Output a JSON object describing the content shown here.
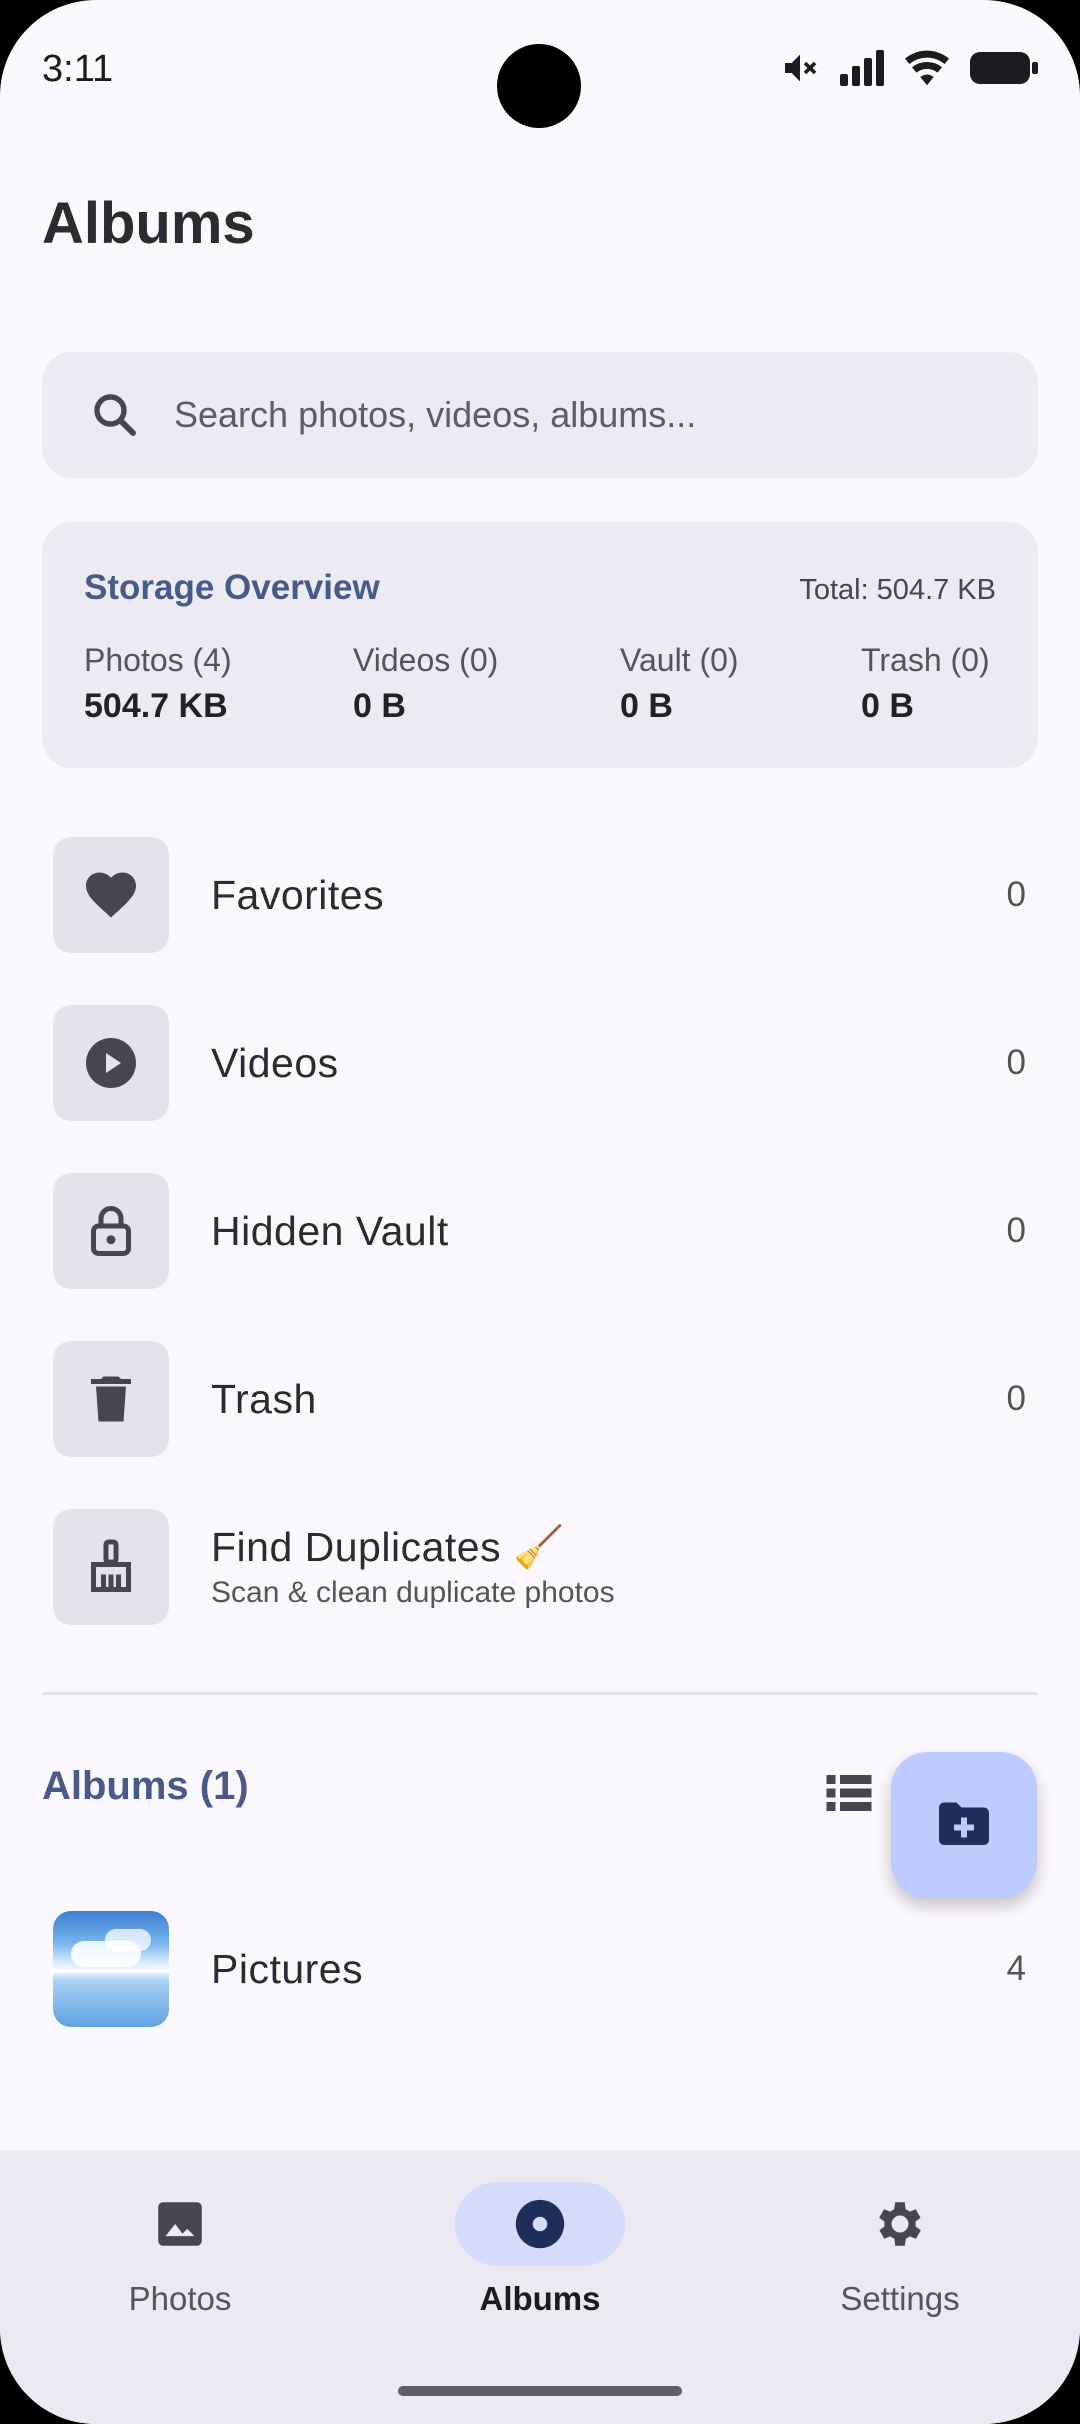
{
  "status_bar": {
    "time": "3:11"
  },
  "page": {
    "title": "Albums"
  },
  "search": {
    "placeholder": "Search photos, videos, albums..."
  },
  "storage": {
    "title": "Storage Overview",
    "total": "Total: 504.7 KB",
    "columns": [
      {
        "label": "Photos (4)",
        "value": "504.7 KB"
      },
      {
        "label": "Videos (0)",
        "value": "0 B"
      },
      {
        "label": "Vault (0)",
        "value": "0 B"
      },
      {
        "label": "Trash (0)",
        "value": "0 B"
      }
    ]
  },
  "quick": [
    {
      "label": "Favorites",
      "count": "0",
      "icon": "heart-icon"
    },
    {
      "label": "Videos",
      "count": "0",
      "icon": "play-circle-icon"
    },
    {
      "label": "Hidden Vault",
      "count": "0",
      "icon": "lock-icon"
    },
    {
      "label": "Trash",
      "count": "0",
      "icon": "trash-icon"
    },
    {
      "label": "Find Duplicates 🧹",
      "sub": "Scan & clean duplicate photos",
      "icon": "broom-icon"
    }
  ],
  "albums": {
    "heading": "Albums (1)",
    "items": [
      {
        "label": "Pictures",
        "count": "4"
      }
    ]
  },
  "nav": [
    {
      "label": "Photos",
      "icon": "image-icon",
      "active": false
    },
    {
      "label": "Albums",
      "icon": "album-icon",
      "active": true
    },
    {
      "label": "Settings",
      "icon": "gear-icon",
      "active": false
    }
  ],
  "colors": {
    "accent": "#4a5a88",
    "fab": "#bccafd",
    "nav_active": "#d5dbf9",
    "surface": "#eceaf2"
  }
}
